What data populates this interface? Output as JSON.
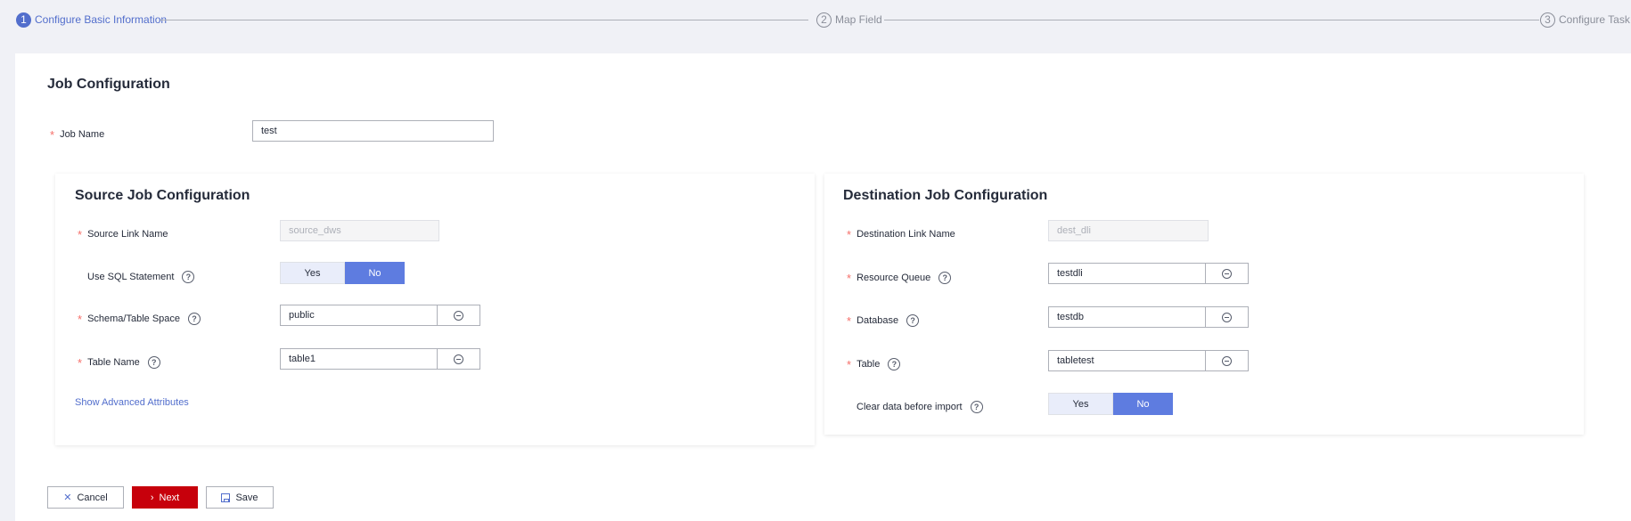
{
  "steps": [
    {
      "num": "1",
      "label": "Configure Basic Information"
    },
    {
      "num": "2",
      "label": "Map Field"
    },
    {
      "num": "3",
      "label": "Configure Task"
    }
  ],
  "job": {
    "title": "Job Configuration",
    "name_label": "Job Name",
    "name_value": "test"
  },
  "source": {
    "title": "Source Job Configuration",
    "link_label": "Source Link Name",
    "link_value": "source_dws",
    "sql_label": "Use SQL Statement",
    "sql_yes": "Yes",
    "sql_no": "No",
    "schema_label": "Schema/Table Space",
    "schema_value": "public",
    "table_label": "Table Name",
    "table_value": "table1",
    "advanced_link": "Show Advanced Attributes"
  },
  "destination": {
    "title": "Destination Job Configuration",
    "link_label": "Destination Link Name",
    "link_value": "dest_dli",
    "queue_label": "Resource Queue",
    "queue_value": "testdli",
    "db_label": "Database",
    "db_value": "testdb",
    "table_label": "Table",
    "table_value": "tabletest",
    "clear_label": "Clear data before import",
    "clear_yes": "Yes",
    "clear_no": "No"
  },
  "footer": {
    "cancel": "Cancel",
    "next": "Next",
    "save": "Save"
  },
  "colors": {
    "accent": "#526ecc",
    "primary_button": "#c7000b",
    "required_star": "#f66f6a"
  }
}
